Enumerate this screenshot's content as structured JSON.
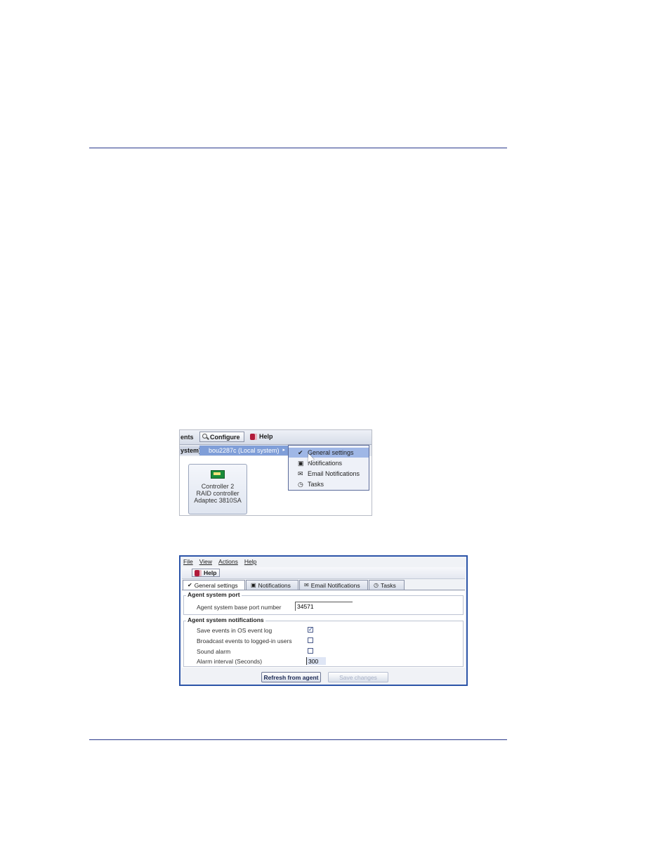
{
  "shot1": {
    "toolbar": {
      "events_label": "ents",
      "configure_label": "Configure",
      "help_label": "Help"
    },
    "row2": {
      "system_label": "ystem)",
      "submenu_label": "bou2287c (Local system)",
      "submenu_arrow": "▸"
    },
    "popup": {
      "items": [
        {
          "label": "General settings",
          "icon": "checkmark-icon"
        },
        {
          "label": "Notifications",
          "icon": "monitor-icon"
        },
        {
          "label": "Email Notifications",
          "icon": "envelope-icon"
        },
        {
          "label": "Tasks",
          "icon": "clock-icon"
        }
      ]
    },
    "controller_card": {
      "line1": "Controller 2",
      "line2": "RAID controller",
      "line3": "Adaptec 3810SA"
    }
  },
  "shot2": {
    "menubar": [
      "File",
      "View",
      "Actions",
      "Help"
    ],
    "toolbar": {
      "help_label": "Help"
    },
    "tabs": [
      {
        "label": "General settings",
        "icon": "checkmark-icon",
        "active": true
      },
      {
        "label": "Notifications",
        "icon": "monitor-icon"
      },
      {
        "label": "Email Notifications",
        "icon": "envelope-icon"
      },
      {
        "label": "Tasks",
        "icon": "clock-icon"
      }
    ],
    "port_group": {
      "title": "Agent system port",
      "field_label": "Agent system base port number",
      "field_value": "34571"
    },
    "notif_group": {
      "title": "Agent system notifications",
      "save_events_label": "Save events in OS event log",
      "save_events_checked": true,
      "broadcast_label": "Broadcast events to logged-in users",
      "broadcast_checked": false,
      "sound_label": "Sound alarm",
      "sound_checked": false,
      "alarm_label": "Alarm interval (Seconds)",
      "alarm_value": "300"
    },
    "buttons": {
      "refresh_label": "Refresh from agent",
      "save_label": "Save changes"
    }
  },
  "colors": {
    "rule": "#2b3a8c",
    "window_border": "#2c54a8",
    "menu_highlight": "#7f9ed8"
  }
}
